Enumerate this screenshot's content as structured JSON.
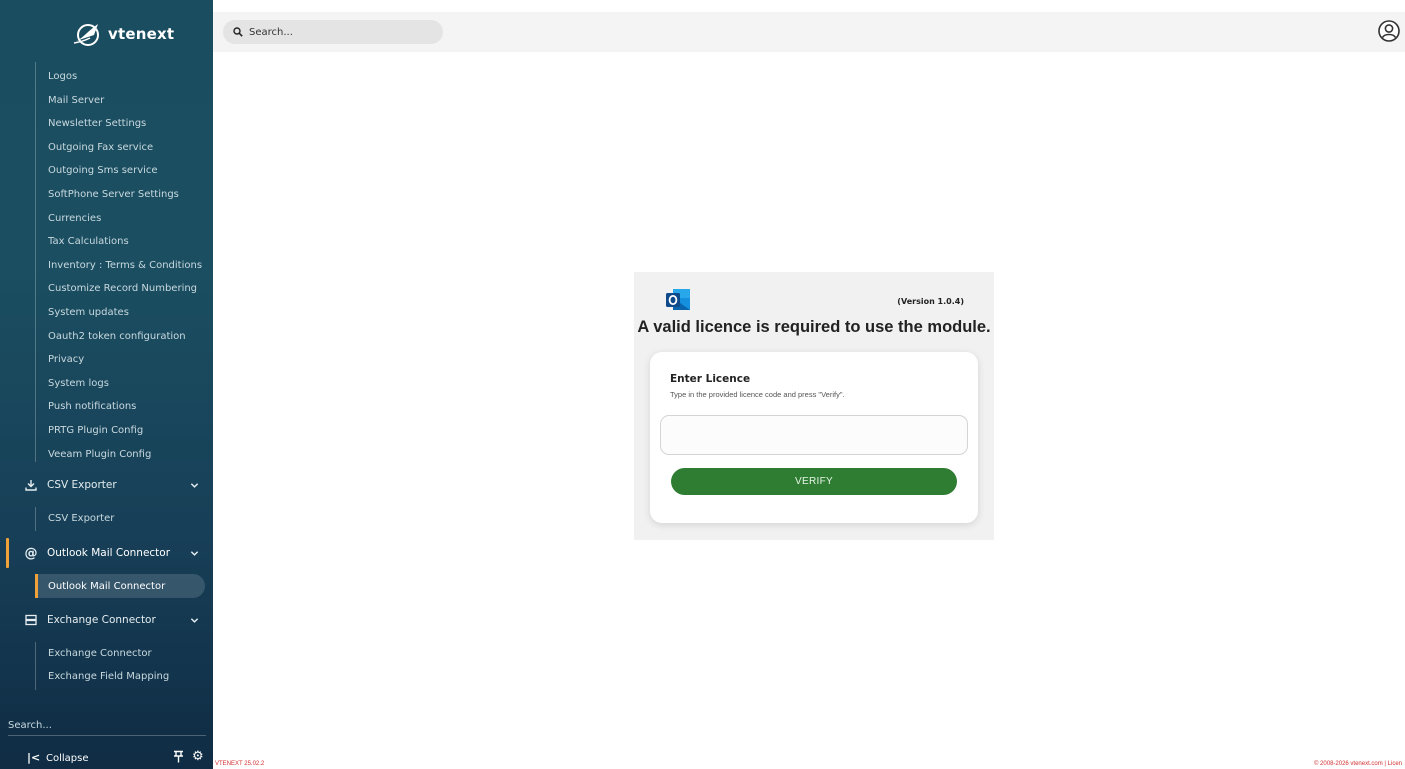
{
  "app": {
    "name": "vtenext"
  },
  "search": {
    "placeholder": "Search..."
  },
  "sidebar": {
    "settings_items": [
      "Logos",
      "Mail Server",
      "Newsletter Settings",
      "Outgoing Fax service",
      "Outgoing Sms service",
      "SoftPhone Server Settings",
      "Currencies",
      "Tax Calculations",
      "Inventory : Terms & Conditions",
      "Customize Record Numbering",
      "System updates",
      "Oauth2 token configuration",
      "Privacy",
      "System logs",
      "Push notifications",
      "PRTG Plugin Config",
      "Veeam Plugin Config"
    ],
    "groups": {
      "csv": {
        "label": "CSV Exporter",
        "icon": "download-icon",
        "items": [
          "CSV Exporter"
        ]
      },
      "outlook": {
        "label": "Outlook Mail Connector",
        "icon": "at-icon",
        "items": [
          "Outlook Mail Connector"
        ],
        "active": true
      },
      "exchange": {
        "label": "Exchange Connector",
        "icon": "server-icon",
        "items": [
          "Exchange Connector",
          "Exchange Field Mapping"
        ]
      }
    },
    "search_label": "Search...",
    "collapse_label": "Collapse"
  },
  "licence": {
    "version": "(Version 1.0.4)",
    "title": "A valid licence is required to use the module.",
    "enter_title": "Enter Licence",
    "enter_subtitle": "Type in the provided licence code and press \"Verify\".",
    "input_value": "",
    "verify_label": "VERIFY"
  },
  "footer": {
    "version": "VTENEXT 25.02.2",
    "copyright": "© 2008-2026 vtenext.com | Licen"
  },
  "colors": {
    "accent": "#f0a23a",
    "verify_button": "#2e7d32",
    "sidebar_top": "#1a4d5f",
    "sidebar_bottom": "#0f2c44",
    "footer_text": "#d32f2f"
  }
}
